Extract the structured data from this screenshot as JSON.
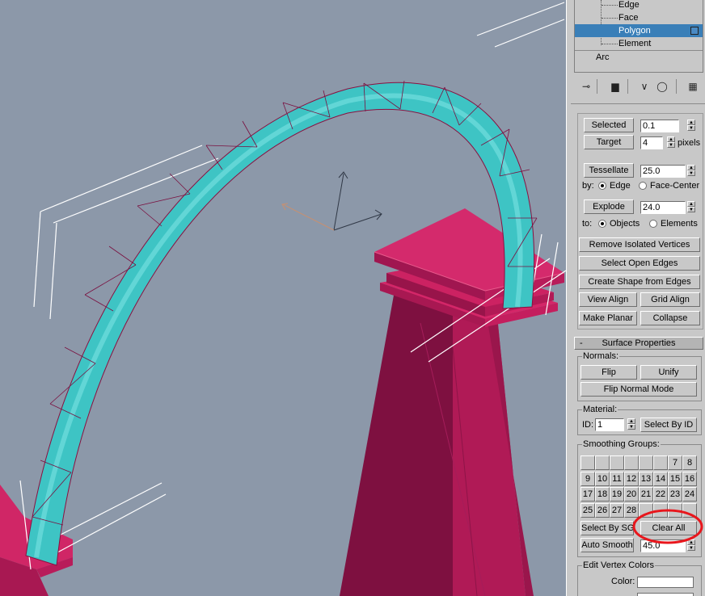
{
  "stack": {
    "items": [
      {
        "label": "Edge"
      },
      {
        "label": "Face"
      },
      {
        "label": "Polygon"
      },
      {
        "label": "Element"
      },
      {
        "label": "Arc"
      }
    ]
  },
  "icons": [
    "pin-stack-icon",
    "show-end-result-icon",
    "make-unique-icon",
    "remove-modifier-icon",
    "configure-modifier-sets-icon"
  ],
  "selected_row": {
    "button": "Selected",
    "value": "0.1"
  },
  "target_row": {
    "button": "Target",
    "value": "4",
    "unit": "pixels"
  },
  "tessellate": {
    "button": "Tessellate",
    "value": "25.0",
    "by_label": "by:",
    "opt_edge": "Edge",
    "opt_face_center": "Face-Center"
  },
  "explode": {
    "button": "Explode",
    "value": "24.0",
    "to_label": "to:",
    "opt_objects": "Objects",
    "opt_elements": "Elements"
  },
  "buttons": {
    "remove_isolated": "Remove Isolated Vertices",
    "select_open_edges": "Select Open Edges",
    "create_shape": "Create Shape from Edges",
    "view_align": "View Align",
    "grid_align": "Grid Align",
    "make_planar": "Make Planar",
    "collapse": "Collapse"
  },
  "surface": {
    "header": "Surface Properties",
    "collapse_sign": "-",
    "normals_title": "Normals:",
    "flip": "Flip",
    "unify": "Unify",
    "flip_normal_mode": "Flip Normal Mode",
    "material_title": "Material:",
    "id_label": "ID:",
    "id_value": "1",
    "select_by_id": "Select By ID",
    "smoothing_title": "Smoothing Groups:",
    "sg_rows": [
      [
        "",
        "",
        "",
        "",
        "",
        "",
        "7",
        "8"
      ],
      [
        "9",
        "10",
        "11",
        "12",
        "13",
        "14",
        "15",
        "16"
      ],
      [
        "17",
        "18",
        "19",
        "20",
        "21",
        "22",
        "23",
        "24"
      ],
      [
        "25",
        "26",
        "27",
        "28",
        "",
        "",
        "",
        ""
      ]
    ],
    "select_by_sg": "Select By SG",
    "clear_all": "Clear All",
    "auto_smooth": "Auto Smooth",
    "auto_smooth_value": "45.0",
    "edit_vertex_colors": "Edit Vertex Colors",
    "color_label": "Color:"
  },
  "colors": {
    "viewport_bg": "#8c98a9",
    "arch": "#3ec4c4",
    "pillar": "#c01c5c",
    "highlight_circle": "#e8161c",
    "selection": "#3a7fb8"
  }
}
